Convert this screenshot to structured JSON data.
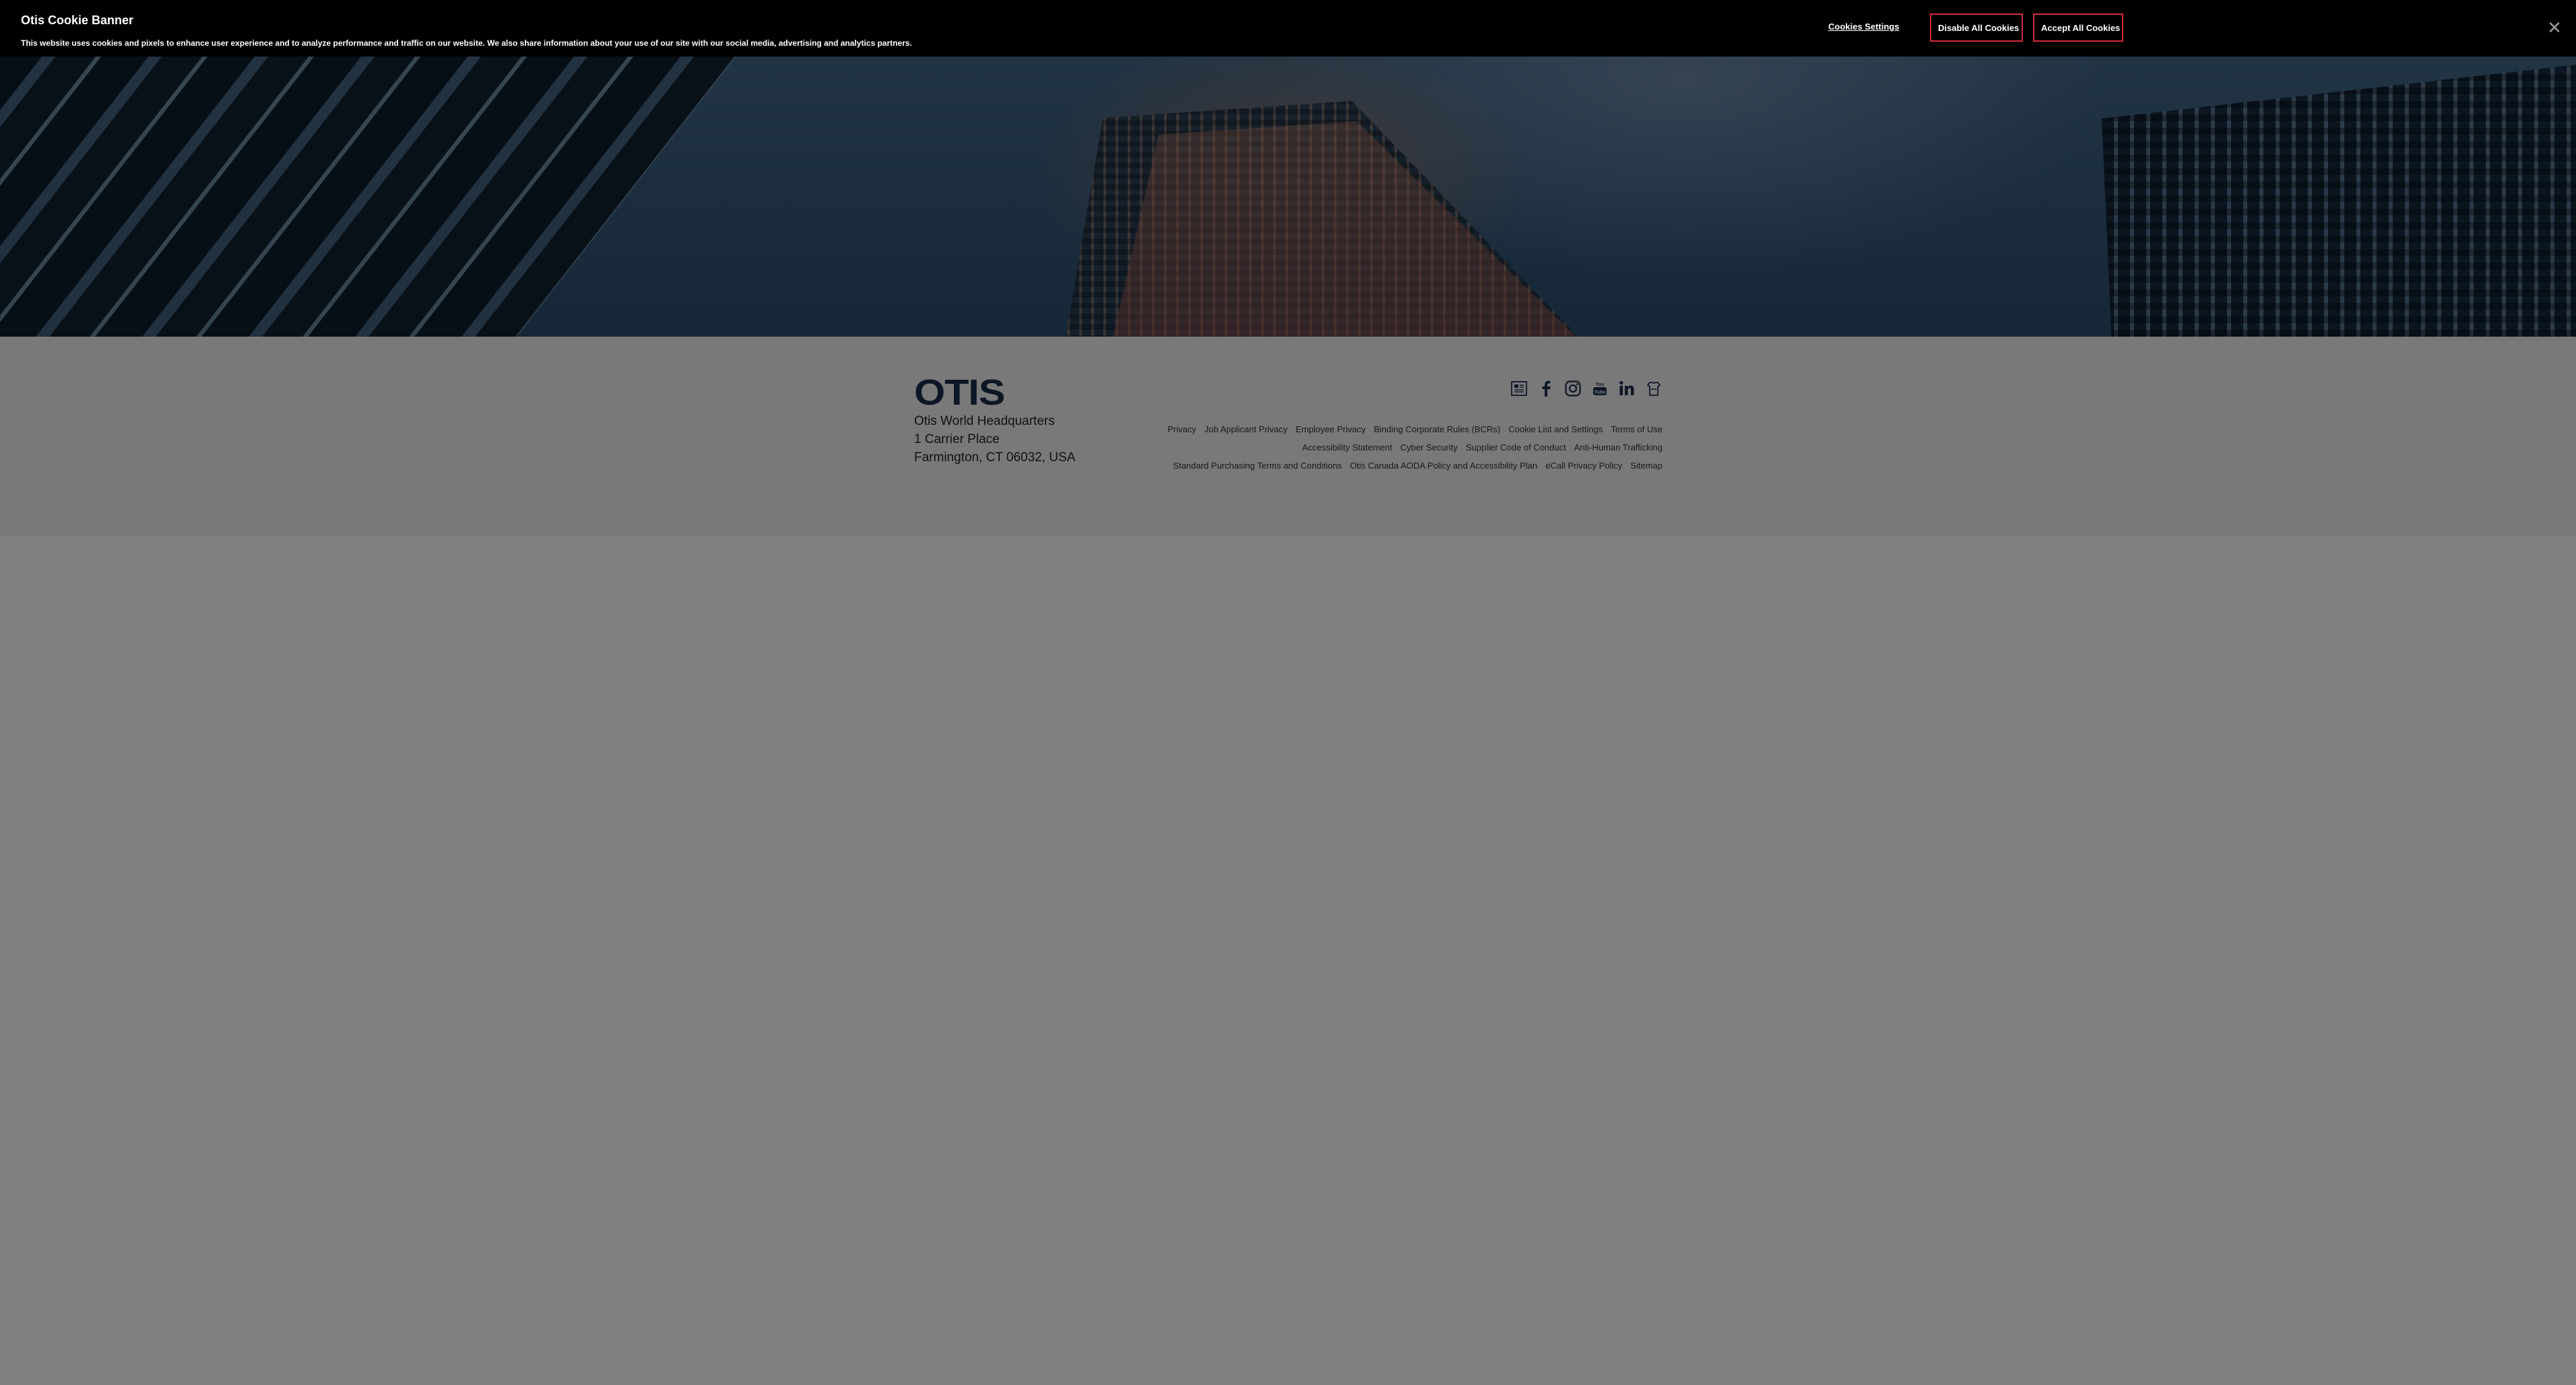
{
  "cookie_banner": {
    "title": "Otis Cookie Banner",
    "text": "This website uses cookies and pixels to enhance user experience and to analyze performance and traffic on our website. We also share information about your use of our site with our social media, advertising and analytics partners.",
    "settings_label": "Cookies Settings",
    "disable_label": "Disable All Cookies",
    "accept_label": "Accept All Cookies",
    "close_icon": "close-icon",
    "close_glyph": "✕",
    "button_border_color": "#d42a3a"
  },
  "footer": {
    "logo": "OTIS",
    "brand_color": "#1b2c4a",
    "address": {
      "line1": "Otis World Headquarters",
      "line2": "1 Carrier Place",
      "line3": "Farmington, CT 06032, USA"
    },
    "social": [
      {
        "name": "news-icon"
      },
      {
        "name": "facebook-icon"
      },
      {
        "name": "instagram-icon"
      },
      {
        "name": "youtube-icon"
      },
      {
        "name": "linkedin-icon"
      },
      {
        "name": "wechat-icon"
      }
    ],
    "legal_links": {
      "row1": [
        "Privacy",
        "Job Applicant Privacy",
        "Employee Privacy",
        "Binding Corporate Rules (BCRs)",
        "Cookie List and Settings",
        "Terms of Use"
      ],
      "row2": [
        "Accessibility Statement",
        "Cyber Security",
        "Supplier Code of Conduct",
        "Anti-Human Trafficking"
      ],
      "row3": [
        "Standard Purchasing Terms and Conditions",
        "Otis Canada AODA Policy and Accessibility Plan",
        "eCall Privacy Policy",
        "Sitemap"
      ]
    }
  }
}
